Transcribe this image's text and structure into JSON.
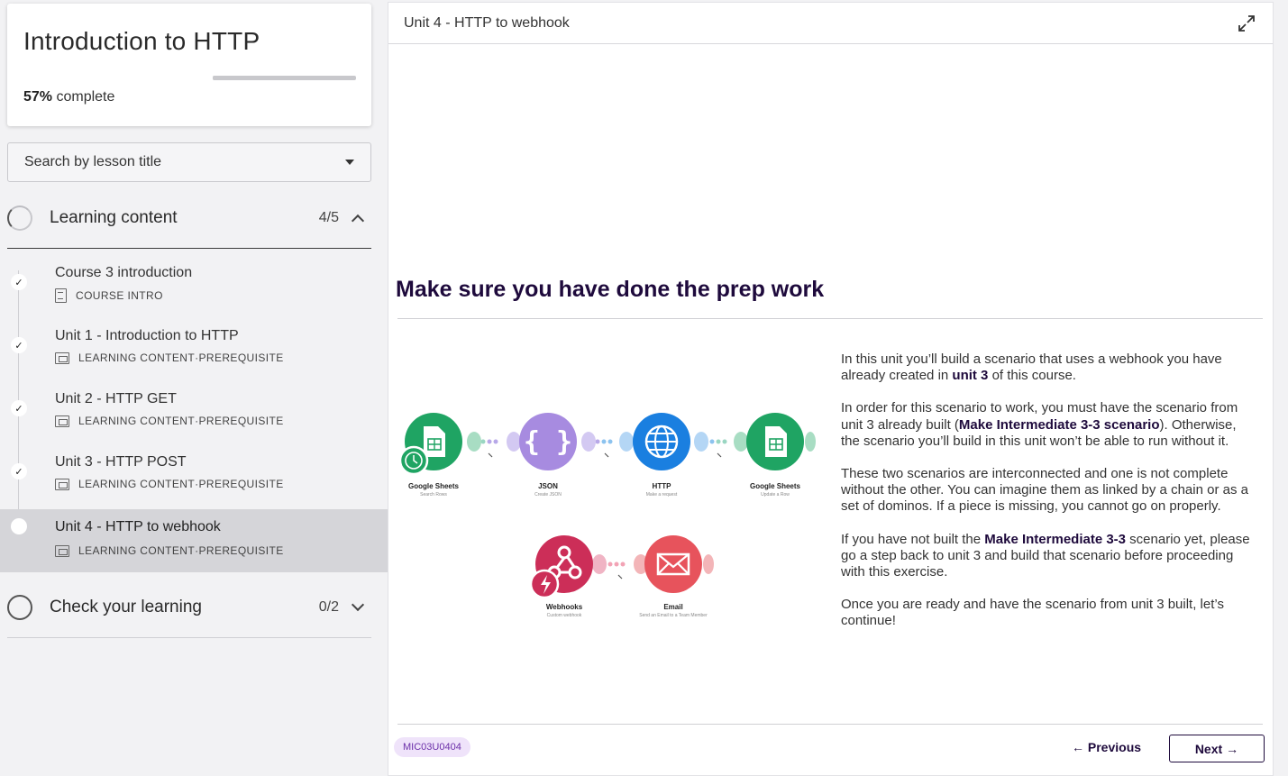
{
  "course": {
    "title": "Introduction to HTTP",
    "progress_percent": "57%",
    "progress_suffix": " complete",
    "progress_fraction": 0.57
  },
  "search": {
    "placeholder": "Search by lesson title"
  },
  "sections": [
    {
      "title": "Learning content",
      "count": "4/5"
    },
    {
      "title": "Check your learning",
      "count": "0/2"
    }
  ],
  "lessons": [
    {
      "title": "Course 3 introduction",
      "type": "COURSE INTRO",
      "tag": "",
      "status": "done"
    },
    {
      "title": "Unit 1 - Introduction to HTTP",
      "type": "LEARNING CONTENT",
      "tag": "PREREQUISITE",
      "status": "done"
    },
    {
      "title": "Unit 2 - HTTP GET",
      "type": "LEARNING CONTENT",
      "tag": "PREREQUISITE",
      "status": "done"
    },
    {
      "title": "Unit 3 - HTTP POST",
      "type": "LEARNING CONTENT",
      "tag": "PREREQUISITE",
      "status": "done"
    },
    {
      "title": "Unit 4 - HTTP to webhook",
      "type": "LEARNING CONTENT",
      "tag": "PREREQUISITE",
      "status": "current"
    }
  ],
  "meta_separator": " · ",
  "check_glyph": "✓",
  "main": {
    "header_title": "Unit 4 - HTTP to webhook",
    "heading": "Make sure you have done the prep work",
    "paragraphs": {
      "p1_a": "In this unit you’ll build a scenario that uses a webhook you have already created in ",
      "p1_b": "unit 3",
      "p1_c": " of this course.",
      "p2_a": "In order for this scenario to work, you must have the scenario from unit 3 already built (",
      "p2_b": "Make Intermediate 3-3 scenario",
      "p2_c": "). Otherwise, the scenario you’ll build in this unit won’t be able to run without it.",
      "p3": "These two scenarios are interconnected and one is not complete without the other. You can imagine them as linked by a chain or as a set of dominos. If a piece is missing, you cannot go on properly.",
      "p4_a": "If you have not built the ",
      "p4_b": "Make Intermediate 3-3",
      "p4_c": " scenario yet, please go a step back to unit 3 and build that scenario before proceeding with this exercise.",
      "p5": "Once you are ready and have the scenario from unit 3 built, let’s continue!"
    },
    "diagram": {
      "row1": [
        {
          "label": "Google Sheets",
          "sub": "Search Rows",
          "icon": "sheets-icon",
          "color": "#1fa463"
        },
        {
          "label": "JSON",
          "sub": "Create JSON",
          "icon": "json-icon",
          "color": "#a78be0"
        },
        {
          "label": "HTTP",
          "sub": "Make a request",
          "icon": "globe-icon",
          "color": "#1a7fe0"
        },
        {
          "label": "Google Sheets",
          "sub": "Update a Row",
          "icon": "sheets-icon",
          "color": "#1fa463"
        }
      ],
      "row2": [
        {
          "label": "Webhooks",
          "sub": "Custom webhook",
          "icon": "webhook-icon",
          "color": "#cc2e58"
        },
        {
          "label": "Email",
          "sub": "Send an Email to a Team Member",
          "icon": "email-icon",
          "color": "#e7535c"
        }
      ]
    },
    "lesson_code": "MIC03U0404",
    "prev_label": "Previous",
    "next_label": "Next"
  },
  "colors": {
    "brand_dark": "#1e0a3c",
    "badge_bg": "#efe3fa",
    "badge_text": "#6b2fa8",
    "active_row": "#d5d5d9"
  }
}
